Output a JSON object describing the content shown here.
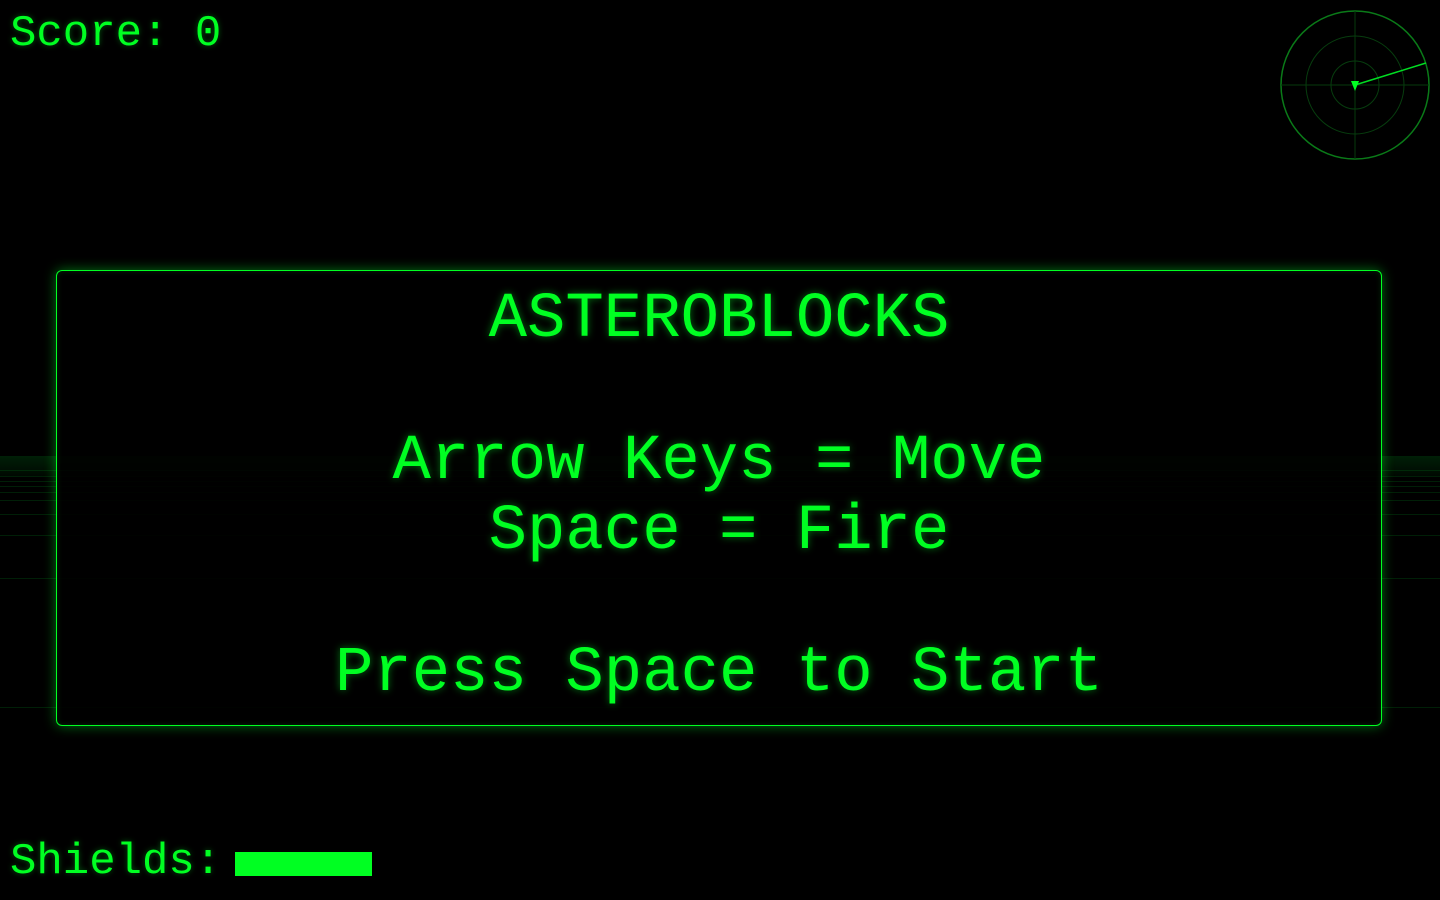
{
  "hud": {
    "score_label": "Score: 0",
    "score_value": 0,
    "shields_label": "Shields:",
    "shields_level": 1.0
  },
  "menu": {
    "title": "ASTEROBLOCKS",
    "move_instruction": "Arrow Keys = Move",
    "fire_instruction": "Space = Fire",
    "start_prompt": "Press Space to Start"
  },
  "radar": {
    "icon": "radar-icon",
    "player_marker_icon": "triangle-down-icon"
  },
  "colors": {
    "primary": "#00ff22",
    "background": "#000000",
    "radar_line": "#0a6a14"
  }
}
